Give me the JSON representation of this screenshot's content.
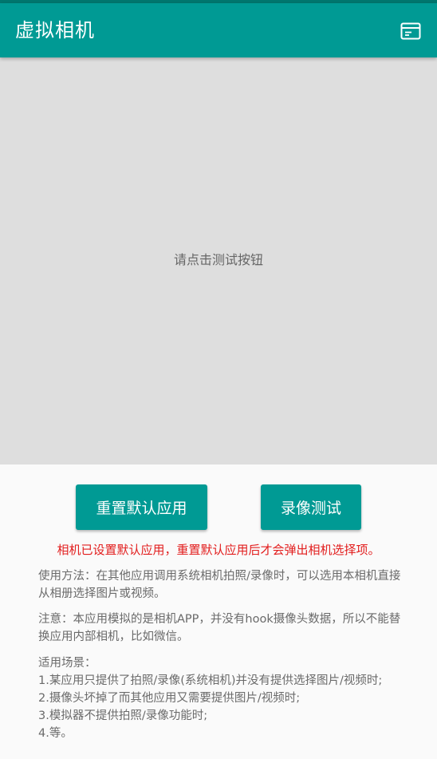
{
  "app": {
    "title": "虚拟相机",
    "menu_icon": "card-icon"
  },
  "preview": {
    "hint": "请点击测试按钮"
  },
  "buttons": {
    "reset_default": "重置默认应用",
    "record_test": "录像测试"
  },
  "warning": "相机已设置默认应用，重置默认应用后才会弹出相机选择项。",
  "usage": "使用方法：在其他应用调用系统相机拍照/录像时，可以选用本相机直接从相册选择图片或视频。",
  "note": "注意：本应用模拟的是相机APP，并没有hook摄像头数据，所以不能替换应用内部相机，比如微信。",
  "scenes": {
    "title": "适用场景：",
    "items": [
      "1.某应用只提供了拍照/录像(系统相机)并没有提供选择图片/视频时;",
      "2.摄像头坏掉了而其他应用又需要提供图片/视频时;",
      "3.模拟器不提供拍照/录像功能时;",
      "4.等。"
    ]
  },
  "colors": {
    "primary": "#009a94",
    "primary_dark": "#00766e",
    "warning": "#e21d1d",
    "preview_bg": "#dedede"
  }
}
